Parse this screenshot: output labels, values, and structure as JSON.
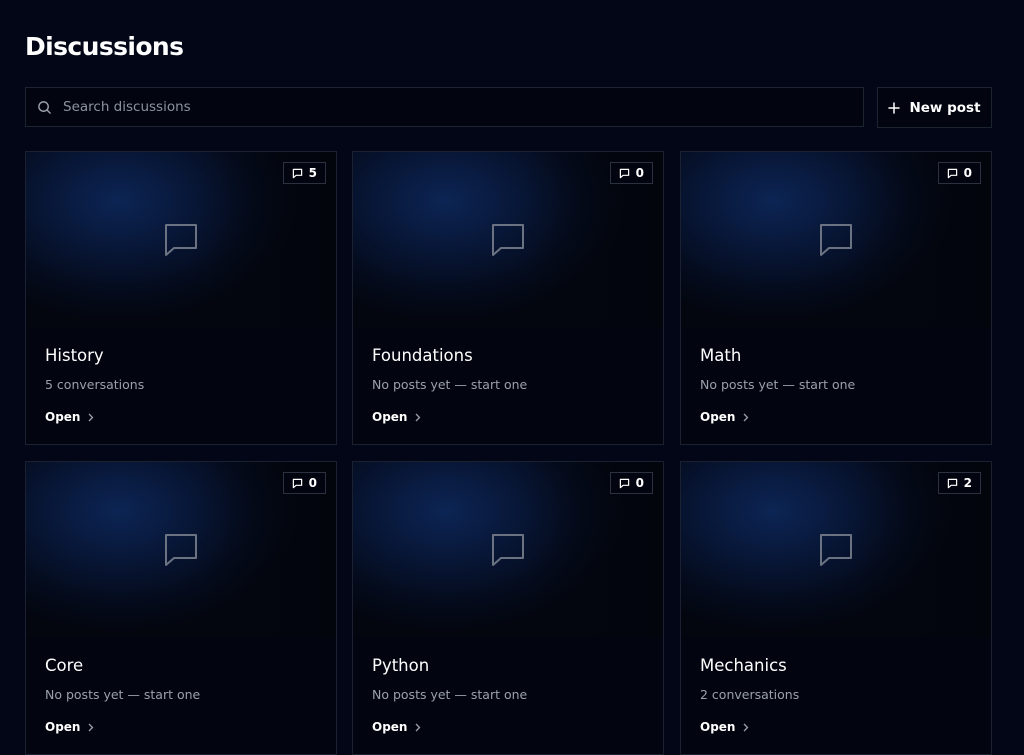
{
  "header": {
    "title": "Discussions"
  },
  "search": {
    "placeholder": "Search discussions",
    "value": ""
  },
  "toolbar": {
    "new_post_label": "New post"
  },
  "cards": [
    {
      "title": "History",
      "subtitle": "5 conversations",
      "count": "5",
      "action": "Open"
    },
    {
      "title": "Foundations",
      "subtitle": "No posts yet — start one",
      "count": "0",
      "action": "Open"
    },
    {
      "title": "Math",
      "subtitle": "No posts yet — start one",
      "count": "0",
      "action": "Open"
    },
    {
      "title": "Core",
      "subtitle": "No posts yet — start one",
      "count": "0",
      "action": "Open"
    },
    {
      "title": "Python",
      "subtitle": "No posts yet — start one",
      "count": "0",
      "action": "Open"
    },
    {
      "title": "Mechanics",
      "subtitle": "2 conversations",
      "count": "2",
      "action": "Open"
    }
  ],
  "icons": {
    "search": "search-icon",
    "new_post": "plus-icon",
    "badge": "comment-icon",
    "placeholder": "chat-bubble-icon",
    "action": "chevron-right-icon"
  },
  "colors": {
    "background": "#020617",
    "card": "#02040f",
    "border": "#1b2130",
    "muted_text": "#9aa1ad"
  }
}
